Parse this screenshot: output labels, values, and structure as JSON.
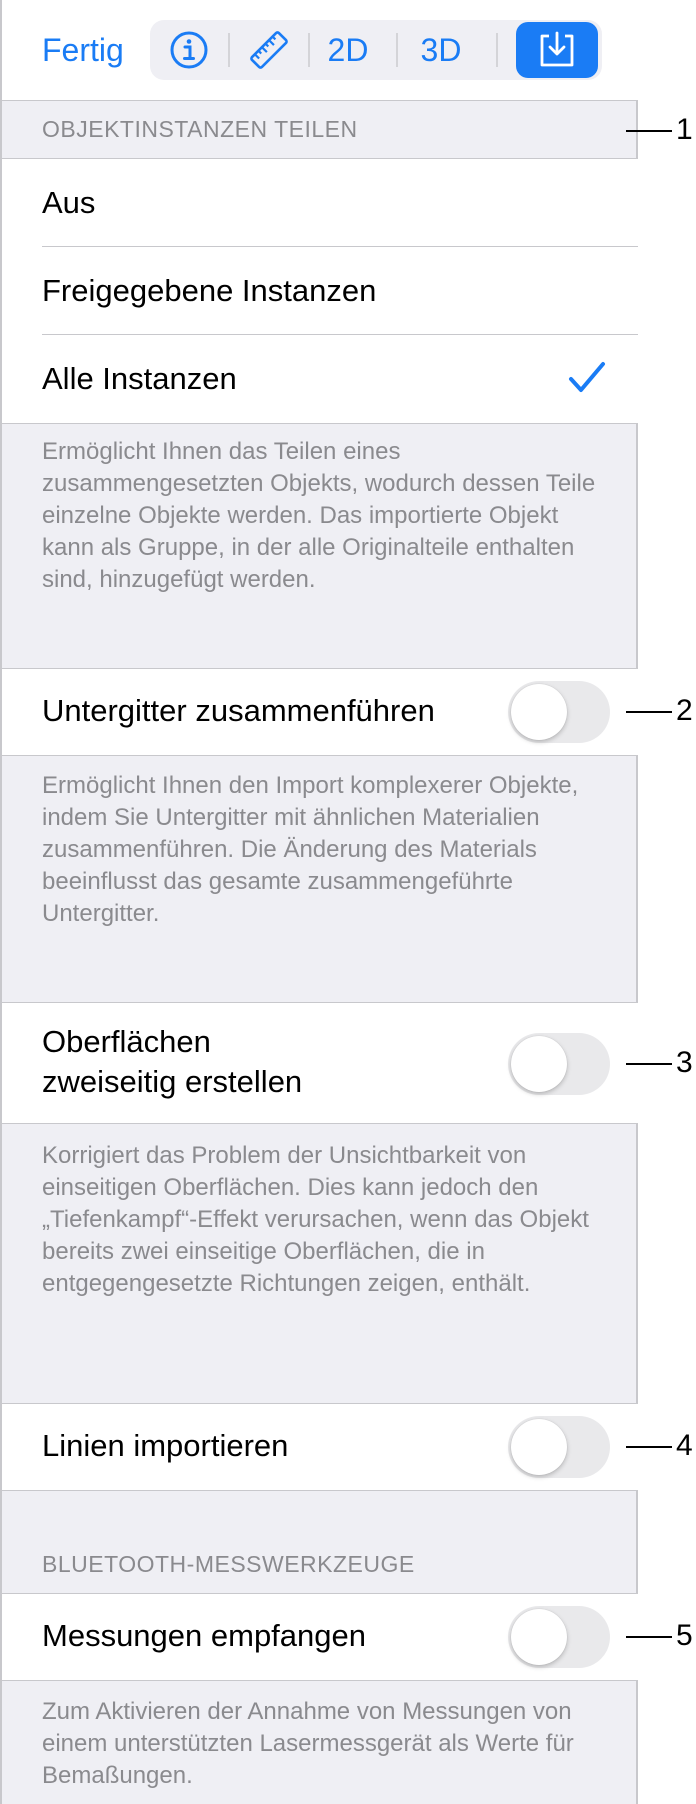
{
  "toolbar": {
    "done_label": "Fertig",
    "info_icon": "info-icon",
    "ruler_icon": "ruler-icon",
    "mode_2d": "2D",
    "mode_3d": "3D",
    "import_icon": "import-icon"
  },
  "object_instances": {
    "header": "OBJEKTINSTANZEN TEILEN",
    "options": [
      {
        "label": "Aus",
        "selected": false
      },
      {
        "label": "Freigegebene Instanzen",
        "selected": false
      },
      {
        "label": "Alle Instanzen",
        "selected": true
      }
    ],
    "description": "Ermöglicht Ihnen das Teilen eines zusammengesetzten Objekts, wodurch dessen Teile einzelne Objekte werden. Das importierte Objekt kann als Gruppe, in der alle Originalteile enthalten sind, hinzugefügt werden."
  },
  "merge_submeshes": {
    "label": "Untergitter zusammenführen",
    "enabled": false,
    "description": "Ermöglicht Ihnen den Import komplexerer Objekte, indem Sie Untergitter mit ähnlichen Materialien zusammenführen. Die Änderung des Materials beeinflusst das gesamte zusammengeführte Untergitter."
  },
  "double_sided": {
    "label_line1": "Oberflächen",
    "label_line2": "zweiseitig erstellen",
    "enabled": false,
    "description": "Korrigiert das Problem der Unsichtbarkeit von einseitigen Oberflächen. Dies kann jedoch den „Tiefenkampf“-Effekt verursachen, wenn das Objekt bereits zwei einseitige Oberflächen, die in entgegengesetzte Richtungen zeigen, enthält."
  },
  "import_lines": {
    "label": "Linien importieren",
    "enabled": false
  },
  "bluetooth": {
    "header": "BLUETOOTH-MESSWERKZEUGE",
    "label": "Messungen empfangen",
    "enabled": false,
    "description": "Zum Aktivieren der Annahme von Messungen von einem unterstützten Lasermessgerät als Werte für Bemaßungen."
  },
  "callouts": [
    "1",
    "2",
    "3",
    "4",
    "5"
  ],
  "colors": {
    "accent": "#1a7cf5",
    "background": "#efeff4",
    "secondary_text": "#8a8a8e",
    "separator": "#c8c8cc",
    "toggle_off": "#e9e9eb"
  }
}
